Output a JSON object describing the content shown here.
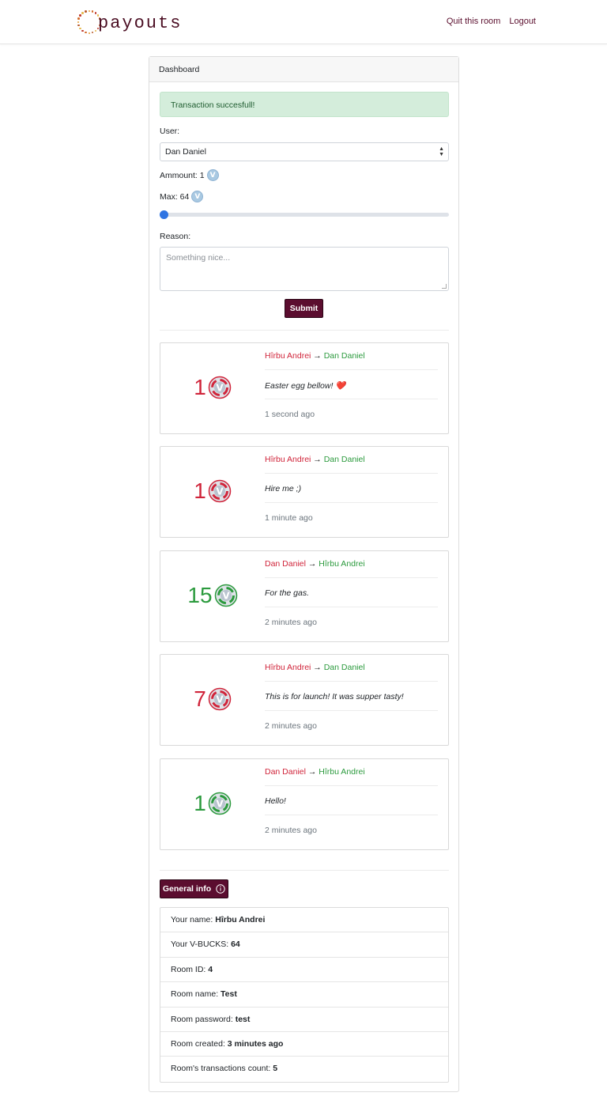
{
  "app": {
    "logo_text": "payouts"
  },
  "nav": {
    "quit_label": "Quit this room",
    "logout_label": "Logout"
  },
  "dashboard": {
    "header": "Dashboard",
    "alert": "Transaction succesfull!",
    "user_label": "User:",
    "user_selected": "Dan Daniel",
    "amount_label": "Ammount: 1",
    "max_label": "Max: 64",
    "slider_value": 1,
    "slider_max": 64,
    "reason_label": "Reason:",
    "reason_placeholder": "Something nice...",
    "submit_label": "Submit"
  },
  "transactions": [
    {
      "amount": "1",
      "direction": "out",
      "from": "Hîrbu Andrei",
      "to": "Dan Daniel",
      "reason": "Easter egg bellow! ❤️",
      "time": "1 second ago"
    },
    {
      "amount": "1",
      "direction": "out",
      "from": "Hîrbu Andrei",
      "to": "Dan Daniel",
      "reason": "Hire me ;)",
      "time": "1 minute ago"
    },
    {
      "amount": "15",
      "direction": "in",
      "from": "Dan Daniel",
      "to": "Hîrbu Andrei",
      "reason": "For the gas.",
      "time": "2 minutes ago"
    },
    {
      "amount": "7",
      "direction": "out",
      "from": "Hîrbu Andrei",
      "to": "Dan Daniel",
      "reason": "This is for launch! It was supper tasty!",
      "time": "2 minutes ago"
    },
    {
      "amount": "1",
      "direction": "in",
      "from": "Dan Daniel",
      "to": "Hîrbu Andrei",
      "reason": "Hello!",
      "time": "2 minutes ago"
    }
  ],
  "general_info": {
    "button_label": "General info",
    "rows": [
      {
        "label": "Your name: ",
        "value": "Hîrbu Andrei"
      },
      {
        "label": "Your V-BUCKS: ",
        "value": "64"
      },
      {
        "label": "Room ID: ",
        "value": "4"
      },
      {
        "label": "Room name: ",
        "value": "Test"
      },
      {
        "label": "Room password: ",
        "value": "test"
      },
      {
        "label": "Room created: ",
        "value": "3 minutes ago"
      },
      {
        "label": "Room's transactions count: ",
        "value": "5"
      }
    ]
  },
  "colors": {
    "brand": "#5b0d2f",
    "negative": "#d0243a",
    "positive": "#2b9a3d",
    "slider": "#2f74e2"
  },
  "icons": {
    "coin": "vbucks-coin-icon",
    "info": "info-circle-icon",
    "arrow": "right-arrow-icon"
  }
}
